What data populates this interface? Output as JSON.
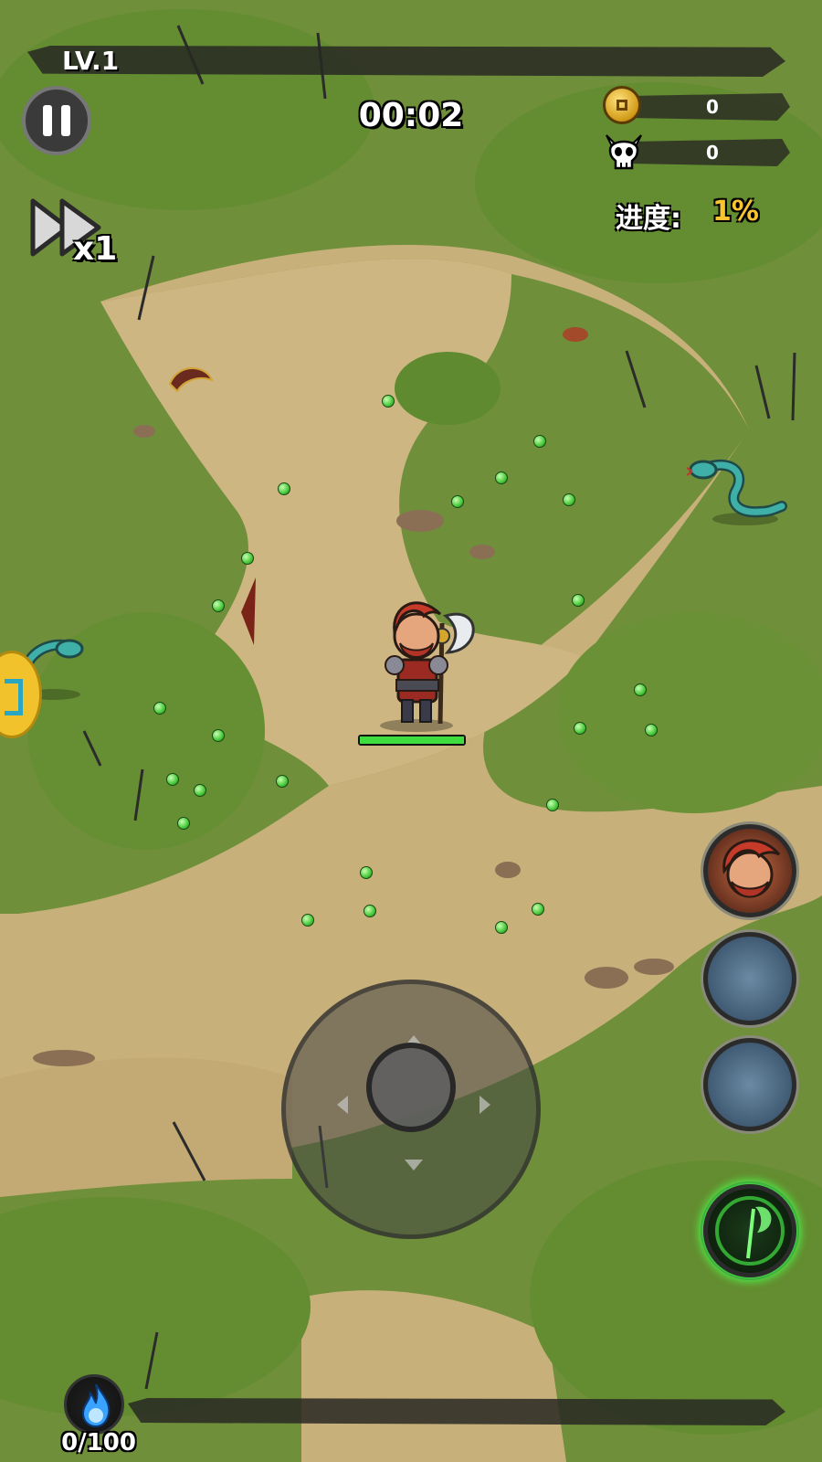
{
  "hud": {
    "level": "LV.1",
    "timer": "00:02",
    "speed": "x1",
    "coins": "0",
    "kills": "0",
    "progress_label": "进度:",
    "progress_value": "1%",
    "soul_count": "0/100"
  },
  "icons": {
    "pause": "pause-icon",
    "speed": "fast-forward-icon",
    "coin": "coin-icon",
    "kills": "skull-icon",
    "soul": "blue-flame-icon",
    "skill_axe": "axe-skill-icon"
  },
  "hero": {
    "hp_fraction": 1.0
  },
  "colors": {
    "grass": "#6f8f3a",
    "path": "#c8b07a",
    "hp": "#3fdc3f",
    "progress": "#f8c531",
    "gem": "#46c93a"
  }
}
